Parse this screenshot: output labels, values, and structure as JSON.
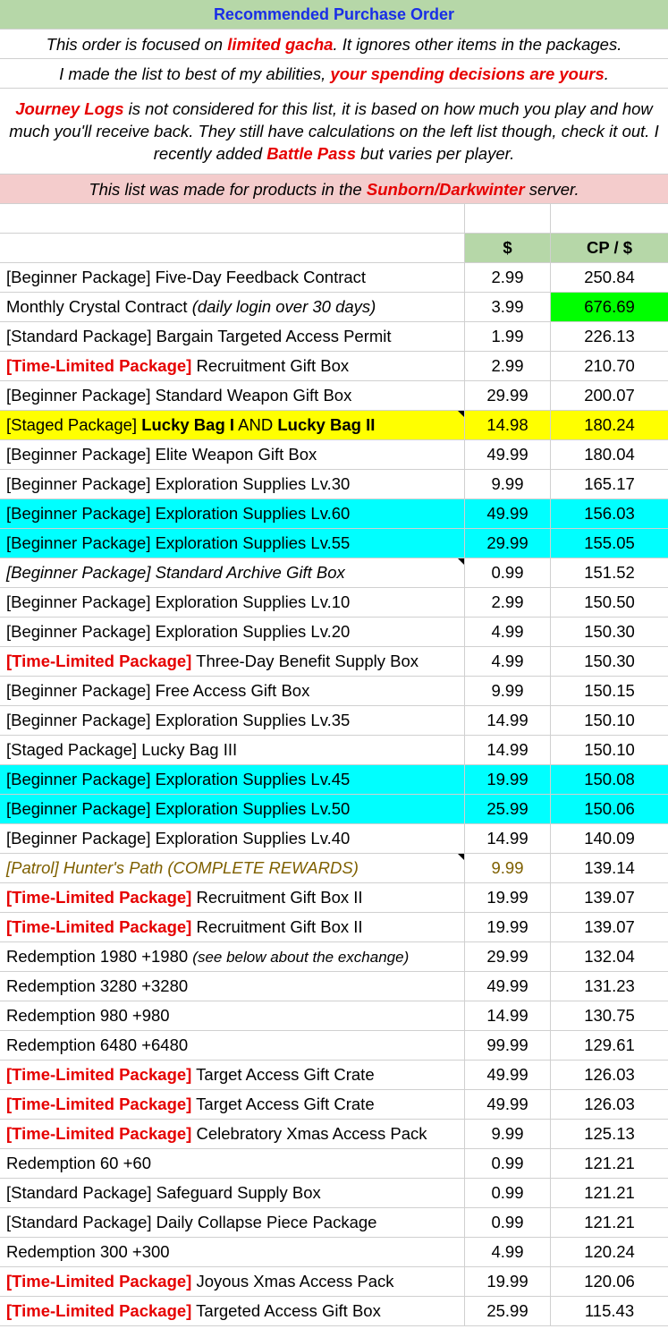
{
  "title": "Recommended Purchase Order",
  "banner1": {
    "pre": "This order is focused on ",
    "highlight": "limited gacha",
    "post": ". It ignores other items in the packages."
  },
  "banner2": {
    "pre": "I made the list to best of my abilities, ",
    "highlight": "your spending decisions are yours",
    "post": "."
  },
  "banner3": {
    "highlight1": "Journey Logs",
    "text1": " is not considered for this list, it is based on how much you play and how much you'll receive back. They still have calculations on the left list though, check it out. I recently added ",
    "highlight2": "Battle Pass",
    "text2": " but varies per player."
  },
  "banner4": {
    "pre": "This list was made for products in the ",
    "highlight": "Sunborn/Darkwinter",
    "post": " server."
  },
  "header": {
    "price": "$",
    "ratio": "CP / $"
  },
  "rows": [
    {
      "tag": "[Beginner Package]",
      "name": " Five-Day Feedback Contract",
      "price": "2.99",
      "ratio": "250.84"
    },
    {
      "tag": "",
      "name": "Monthly Crystal Contract ",
      "note": "(daily login over 30 days)",
      "price": "3.99",
      "ratio": "676.69"
    },
    {
      "tag": "[Standard Package]",
      "name": " Bargain Targeted Access Permit",
      "price": "1.99",
      "ratio": "226.13"
    },
    {
      "tag": "[Time-Limited Package]",
      "name": " Recruitment Gift Box",
      "price": "2.99",
      "ratio": "210.70"
    },
    {
      "tag": "[Beginner Package]",
      "name": " Standard Weapon Gift Box",
      "price": "29.99",
      "ratio": "200.07"
    },
    {
      "tag": "[Staged Package] ",
      "b1": "Lucky Bag I",
      "mid": " AND ",
      "b2": "Lucky Bag II",
      "price": "14.98",
      "ratio": "180.24"
    },
    {
      "tag": "[Beginner Package]",
      "name": " Elite Weapon Gift Box",
      "price": "49.99",
      "ratio": "180.04"
    },
    {
      "tag": "[Beginner Package]",
      "name": " Exploration Supplies Lv.30",
      "price": "9.99",
      "ratio": "165.17"
    },
    {
      "tag": "[Beginner Package]",
      "name": " Exploration Supplies Lv.60",
      "price": "49.99",
      "ratio": "156.03"
    },
    {
      "tag": "[Beginner Package]",
      "name": " Exploration Supplies Lv.55",
      "price": "29.99",
      "ratio": "155.05"
    },
    {
      "tag": "[Beginner Package]",
      "name": " Standard Archive Gift Box",
      "price": "0.99",
      "ratio": "151.52"
    },
    {
      "tag": "[Beginner Package]",
      "name": " Exploration Supplies Lv.10",
      "price": "2.99",
      "ratio": "150.50"
    },
    {
      "tag": "[Beginner Package]",
      "name": " Exploration Supplies Lv.20",
      "price": "4.99",
      "ratio": "150.30"
    },
    {
      "tag": "[Time-Limited Package]",
      "name": " Three-Day Benefit Supply Box",
      "price": "4.99",
      "ratio": "150.30"
    },
    {
      "tag": "[Beginner Package]",
      "name": " Free Access Gift Box",
      "price": "9.99",
      "ratio": "150.15"
    },
    {
      "tag": "[Beginner Package]",
      "name": " Exploration Supplies Lv.35",
      "price": "14.99",
      "ratio": "150.10"
    },
    {
      "tag": "[Staged Package]",
      "name": " Lucky Bag III",
      "price": "14.99",
      "ratio": "150.10"
    },
    {
      "tag": "[Beginner Package]",
      "name": " Exploration Supplies Lv.45",
      "price": "19.99",
      "ratio": "150.08"
    },
    {
      "tag": "[Beginner Package]",
      "name": " Exploration Supplies Lv.50",
      "price": "25.99",
      "ratio": "150.06"
    },
    {
      "tag": "[Beginner Package]",
      "name": " Exploration Supplies Lv.40",
      "price": "14.99",
      "ratio": "140.09"
    },
    {
      "tag": "[Patrol]",
      "name": " Hunter's Path (COMPLETE REWARDS)",
      "price": "9.99",
      "ratio": "139.14"
    },
    {
      "tag": "[Time-Limited Package]",
      "name": " Recruitment Gift Box II",
      "price": "19.99",
      "ratio": "139.07"
    },
    {
      "tag": "[Time-Limited Package]",
      "name": " Recruitment Gift Box II",
      "price": "19.99",
      "ratio": "139.07"
    },
    {
      "tag": "",
      "name": "Redemption 1980 +1980 ",
      "note": "(see below about the exchange)",
      "price": "29.99",
      "ratio": "132.04"
    },
    {
      "tag": "",
      "name": "Redemption 3280 +3280",
      "price": "49.99",
      "ratio": "131.23"
    },
    {
      "tag": "",
      "name": "Redemption 980 +980",
      "price": "14.99",
      "ratio": "130.75"
    },
    {
      "tag": "",
      "name": "Redemption 6480 +6480",
      "price": "99.99",
      "ratio": "129.61"
    },
    {
      "tag": "[Time-Limited Package]",
      "name": " Target Access Gift Crate",
      "price": "49.99",
      "ratio": "126.03"
    },
    {
      "tag": "[Time-Limited Package]",
      "name": " Target Access Gift Crate",
      "price": "49.99",
      "ratio": "126.03"
    },
    {
      "tag": "[Time-Limited Package]",
      "name": " Celebratory Xmas Access Pack",
      "price": "9.99",
      "ratio": "125.13"
    },
    {
      "tag": "",
      "name": "Redemption 60 +60",
      "price": "0.99",
      "ratio": "121.21"
    },
    {
      "tag": "[Standard Package]",
      "name": " Safeguard Supply Box",
      "price": "0.99",
      "ratio": "121.21"
    },
    {
      "tag": "[Standard Package]",
      "name": " Daily Collapse Piece Package",
      "price": "0.99",
      "ratio": "121.21"
    },
    {
      "tag": "",
      "name": "Redemption 300 +300",
      "price": "4.99",
      "ratio": "120.24"
    },
    {
      "tag": "[Time-Limited Package]",
      "name": " Joyous Xmas Access Pack",
      "price": "19.99",
      "ratio": "120.06"
    },
    {
      "tag": "[Time-Limited Package]",
      "name": " Targeted Access Gift Box",
      "price": "25.99",
      "ratio": "115.43"
    }
  ],
  "colors": {
    "title_bg": "#b6d7a8",
    "title_text": "#1a2ee6",
    "red": "#e60000",
    "yellow": "#ffff00",
    "cyan": "#00ffff",
    "green": "#00ff00",
    "pink": "#f4cccc",
    "brown": "#7f6000"
  }
}
